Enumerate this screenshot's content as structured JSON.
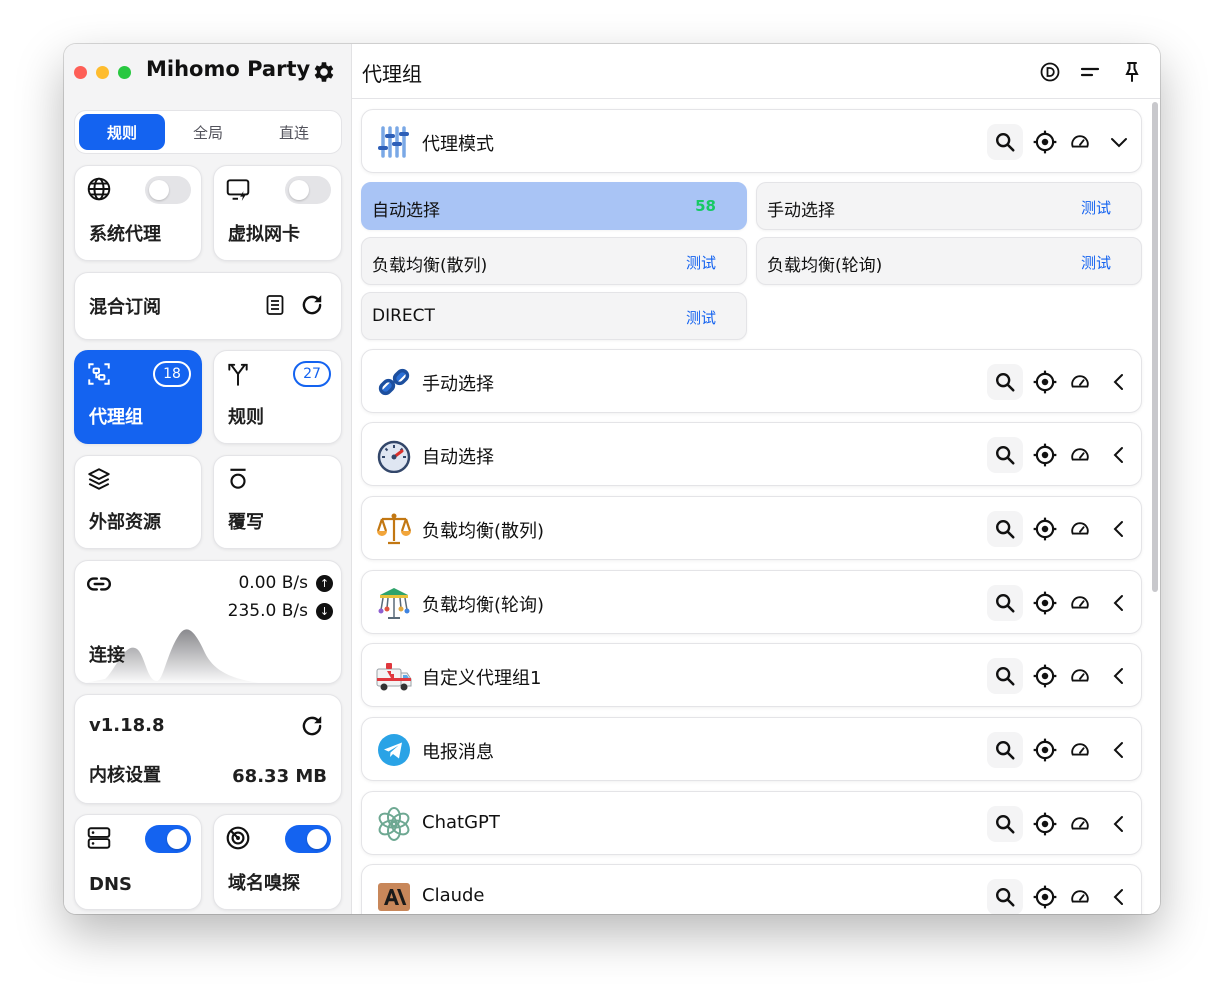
{
  "app": {
    "title": "Mihomo Party"
  },
  "sidebar": {
    "modes": [
      {
        "label": "规则",
        "active": true
      },
      {
        "label": "全局",
        "active": false
      },
      {
        "label": "直连",
        "active": false
      }
    ],
    "system_proxy": {
      "label": "系统代理",
      "icon": "globe-icon",
      "enabled": false
    },
    "tun": {
      "label": "虚拟网卡",
      "icon": "screen-bolt-icon",
      "enabled": false
    },
    "subscription": {
      "label": "混合订阅"
    },
    "proxy_groups": {
      "label": "代理组",
      "count": "18",
      "active": true
    },
    "rules": {
      "label": "规则",
      "count": "27"
    },
    "resources": {
      "label": "外部资源"
    },
    "override": {
      "label": "覆写"
    },
    "connections": {
      "label": "连接",
      "upload": "0.00 B/s",
      "download": "235.0 B/s"
    },
    "core": {
      "version": "v1.18.8",
      "label": "内核设置",
      "memory": "68.33 MB"
    },
    "dns": {
      "label": "DNS",
      "enabled": true
    },
    "sniff": {
      "label": "域名嗅探",
      "enabled": true
    }
  },
  "main": {
    "title": "代理组",
    "groups": [
      {
        "name": "代理模式",
        "icon": "sliders-icon",
        "expanded": true,
        "proxies": [
          {
            "name": "自动选择",
            "delay": "58",
            "selected": true
          },
          {
            "name": "手动选择",
            "delay": "测试",
            "selected": false
          },
          {
            "name": "负载均衡(散列)",
            "delay": "测试",
            "selected": false
          },
          {
            "name": "负载均衡(轮询)",
            "delay": "测试",
            "selected": false
          },
          {
            "name": "DIRECT",
            "delay": "测试",
            "selected": false
          }
        ]
      },
      {
        "name": "手动选择",
        "icon": "link-icon"
      },
      {
        "name": "自动选择",
        "icon": "speedometer-icon"
      },
      {
        "name": "负载均衡(散列)",
        "icon": "scales-icon"
      },
      {
        "name": "负载均衡(轮询)",
        "icon": "carousel-icon"
      },
      {
        "name": "自定义代理组1",
        "icon": "ambulance-icon"
      },
      {
        "name": "电报消息",
        "icon": "telegram-icon"
      },
      {
        "name": "ChatGPT",
        "icon": "openai-icon"
      },
      {
        "name": "Claude",
        "icon": "anthropic-icon"
      }
    ]
  },
  "colors": {
    "accent": "#1463f0",
    "selected_proxy": "#a9c4f5",
    "good_delay": "#17c964"
  }
}
